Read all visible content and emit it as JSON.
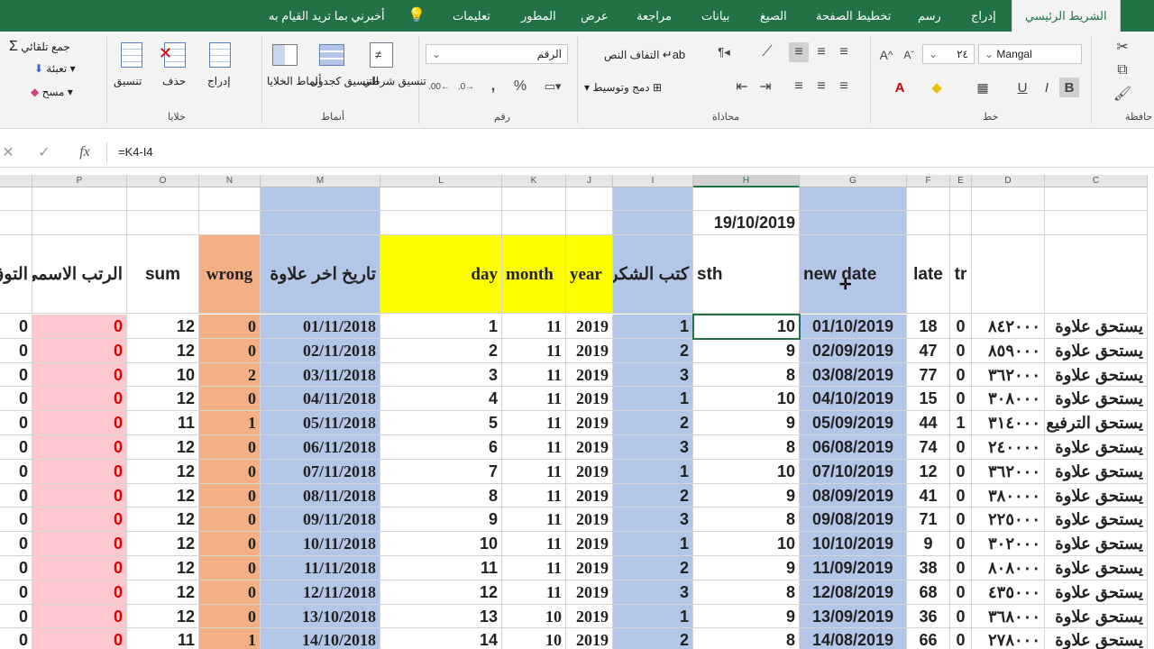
{
  "menu": {
    "tabs": [
      "الشريط الرئيسي",
      "إدراج",
      "رسم",
      "تخطيط الصفحة",
      "الصيغ",
      "بيانات",
      "مراجعة",
      "عرض",
      "المطور",
      "تعليمات"
    ],
    "tell_me": "أخبرني بما تريد القيام به"
  },
  "ribbon": {
    "clipboard_group": "حافظة",
    "font_group": "خط",
    "font_name": "Mangal",
    "font_size": "٢٤",
    "alignment_group": "محاذاة",
    "wrap_text": "التفاف النص",
    "merge_center": "دمج وتوسيط",
    "number_group": "رقم",
    "number_format": "الرقم",
    "styles_group": "أنماط",
    "conditional_format": "تنسيق شرطي",
    "format_table": "التنسيق كجدول",
    "cell_styles": "أنماط الخلايا",
    "cells_group": "خلايا",
    "insert": "إدراج",
    "delete": "حذف",
    "format": "تنسيق",
    "autosum": "جمع تلقائي",
    "fill": "تعبئة",
    "clear": "مسح"
  },
  "formula": {
    "value": "=K4-I4"
  },
  "columns": [
    "P",
    "O",
    "N",
    "M",
    "L",
    "K",
    "J",
    "I",
    "H",
    "G",
    "F",
    "E",
    "D",
    "C"
  ],
  "header_row": {
    "Q": "التوق",
    "P": "الرتب الاسمي",
    "O": "sum",
    "N": "wrong",
    "M": "تاريخ اخر علاوة",
    "L": "day",
    "K": "month",
    "J": "year",
    "I": "كتب الشكر",
    "H": "sth",
    "G": "new date",
    "F": "late",
    "E": "tr"
  },
  "h2_value": "19/10/2019",
  "rows": [
    {
      "Q": "0",
      "P": "0",
      "O": "12",
      "N": "0",
      "M": "01/11/2018",
      "L": "1",
      "K": "11",
      "J": "2019",
      "I": "1",
      "H": "10",
      "G": "01/10/2019",
      "F": "18",
      "E": "0",
      "D": "٨٤٢٠٠٠",
      "C": "يستحق علاوة"
    },
    {
      "Q": "0",
      "P": "0",
      "O": "12",
      "N": "0",
      "M": "02/11/2018",
      "L": "2",
      "K": "11",
      "J": "2019",
      "I": "2",
      "H": "9",
      "G": "02/09/2019",
      "F": "47",
      "E": "0",
      "D": "٨٥٩٠٠٠",
      "C": "يستحق علاوة"
    },
    {
      "Q": "0",
      "P": "0",
      "O": "10",
      "N": "2",
      "M": "03/11/2018",
      "L": "3",
      "K": "11",
      "J": "2019",
      "I": "3",
      "H": "8",
      "G": "03/08/2019",
      "F": "77",
      "E": "0",
      "D": "٣٦٢٠٠٠",
      "C": "يستحق علاوة"
    },
    {
      "Q": "0",
      "P": "0",
      "O": "12",
      "N": "0",
      "M": "04/11/2018",
      "L": "4",
      "K": "11",
      "J": "2019",
      "I": "1",
      "H": "10",
      "G": "04/10/2019",
      "F": "15",
      "E": "0",
      "D": "٣٠٨٠٠٠",
      "C": "يستحق علاوة"
    },
    {
      "Q": "0",
      "P": "0",
      "O": "11",
      "N": "1",
      "M": "05/11/2018",
      "L": "5",
      "K": "11",
      "J": "2019",
      "I": "2",
      "H": "9",
      "G": "05/09/2019",
      "F": "44",
      "E": "1",
      "D": "٣١٤٠٠٠",
      "C": "يستحق الترفيع"
    },
    {
      "Q": "0",
      "P": "0",
      "O": "12",
      "N": "0",
      "M": "06/11/2018",
      "L": "6",
      "K": "11",
      "J": "2019",
      "I": "3",
      "H": "8",
      "G": "06/08/2019",
      "F": "74",
      "E": "0",
      "D": "٢٤٠٠٠٠",
      "C": "يستحق علاوة"
    },
    {
      "Q": "0",
      "P": "0",
      "O": "12",
      "N": "0",
      "M": "07/11/2018",
      "L": "7",
      "K": "11",
      "J": "2019",
      "I": "1",
      "H": "10",
      "G": "07/10/2019",
      "F": "12",
      "E": "0",
      "D": "٣٦٢٠٠٠",
      "C": "يستحق علاوة"
    },
    {
      "Q": "0",
      "P": "0",
      "O": "12",
      "N": "0",
      "M": "08/11/2018",
      "L": "8",
      "K": "11",
      "J": "2019",
      "I": "2",
      "H": "9",
      "G": "08/09/2019",
      "F": "41",
      "E": "0",
      "D": "٣٨٠٠٠٠",
      "C": "يستحق علاوة"
    },
    {
      "Q": "0",
      "P": "0",
      "O": "12",
      "N": "0",
      "M": "09/11/2018",
      "L": "9",
      "K": "11",
      "J": "2019",
      "I": "3",
      "H": "8",
      "G": "09/08/2019",
      "F": "71",
      "E": "0",
      "D": "٢٢٥٠٠٠",
      "C": "يستحق علاوة"
    },
    {
      "Q": "0",
      "P": "0",
      "O": "12",
      "N": "0",
      "M": "10/11/2018",
      "L": "10",
      "K": "11",
      "J": "2019",
      "I": "1",
      "H": "10",
      "G": "10/10/2019",
      "F": "9",
      "E": "0",
      "D": "٣٠٢٠٠٠",
      "C": "يستحق علاوة"
    },
    {
      "Q": "0",
      "P": "0",
      "O": "12",
      "N": "0",
      "M": "11/11/2018",
      "L": "11",
      "K": "11",
      "J": "2019",
      "I": "2",
      "H": "9",
      "G": "11/09/2019",
      "F": "38",
      "E": "0",
      "D": "٨٠٨٠٠٠",
      "C": "يستحق علاوة"
    },
    {
      "Q": "0",
      "P": "0",
      "O": "12",
      "N": "0",
      "M": "12/11/2018",
      "L": "12",
      "K": "11",
      "J": "2019",
      "I": "3",
      "H": "8",
      "G": "12/08/2019",
      "F": "68",
      "E": "0",
      "D": "٤٣٥٠٠٠",
      "C": "يستحق علاوة"
    },
    {
      "Q": "0",
      "P": "0",
      "O": "12",
      "N": "0",
      "M": "13/10/2018",
      "L": "13",
      "K": "10",
      "J": "2019",
      "I": "1",
      "H": "9",
      "G": "13/09/2019",
      "F": "36",
      "E": "0",
      "D": "٣٦٨٠٠٠",
      "C": "يستحق علاوة"
    },
    {
      "Q": "0",
      "P": "0",
      "O": "11",
      "N": "1",
      "M": "14/10/2018",
      "L": "14",
      "K": "10",
      "J": "2019",
      "I": "2",
      "H": "8",
      "G": "14/08/2019",
      "F": "66",
      "E": "0",
      "D": "٢٧٨٠٠٠",
      "C": "يستحق علاوة"
    }
  ]
}
